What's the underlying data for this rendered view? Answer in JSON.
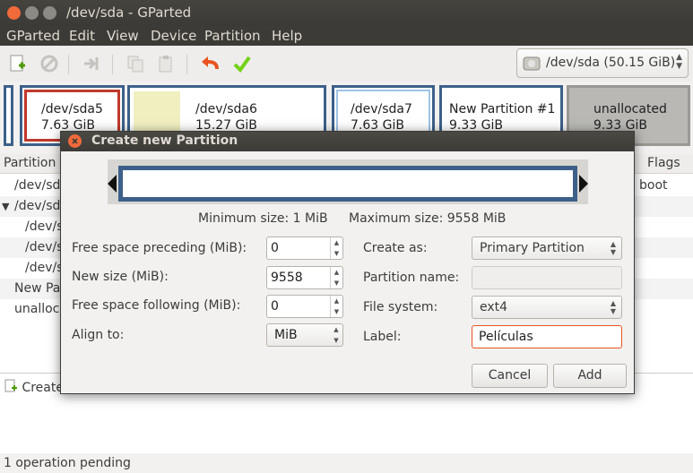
{
  "window": {
    "title": "/dev/sda - GParted"
  },
  "menubar": [
    "GParted",
    "Edit",
    "View",
    "Device",
    "Partition",
    "Help"
  ],
  "device": {
    "label": "/dev/sda  (50.15 GiB)"
  },
  "partition_map": [
    {
      "name": "/dev/sda5",
      "size": "7.63 GiB"
    },
    {
      "name": "/dev/sda6",
      "size": "15.27 GiB"
    },
    {
      "name": "/dev/sda7",
      "size": "7.63 GiB"
    },
    {
      "name": "New Partition #1",
      "size": "9.33 GiB"
    },
    {
      "name": "unallocated",
      "size": "9.33 GiB"
    }
  ],
  "list": {
    "col_partition": "Partition",
    "col_flags": "Flags",
    "rows": [
      {
        "name": "/dev/sd",
        "flags": "boot"
      },
      {
        "name": "/dev/sd",
        "flags": ""
      },
      {
        "name": "/dev/s",
        "flags": ""
      },
      {
        "name": "/dev/s",
        "flags": ""
      },
      {
        "name": "/dev/s",
        "flags": ""
      },
      {
        "name": "New Pa",
        "flags": ""
      },
      {
        "name": "unalloc",
        "flags": ""
      }
    ]
  },
  "operations": {
    "line": "Create"
  },
  "status": "1 operation pending",
  "dialog": {
    "title": "Create new Partition",
    "min_size": "Minimum size: 1 MiB",
    "max_size": "Maximum size: 9558 MiB",
    "free_before_label": "Free space preceding (MiB):",
    "free_before_value": "0",
    "new_size_label": "New size (MiB):",
    "new_size_value": "9558",
    "free_after_label": "Free space following (MiB):",
    "free_after_value": "0",
    "align_label": "Align to:",
    "align_value": "MiB",
    "create_as_label": "Create as:",
    "create_as_value": "Primary Partition",
    "partition_name_label": "Partition name:",
    "partition_name_value": "",
    "filesystem_label": "File system:",
    "filesystem_value": "ext4",
    "label_label": "Label:",
    "label_value": "Películas",
    "cancel": "Cancel",
    "add": "Add"
  },
  "colors": {
    "partition_border": "#3c6089",
    "ext4_fill": "#9ec4e8",
    "ntfs_fill": "#f0efc0",
    "selected_border": "#c0392b",
    "accent": "#e95420"
  }
}
